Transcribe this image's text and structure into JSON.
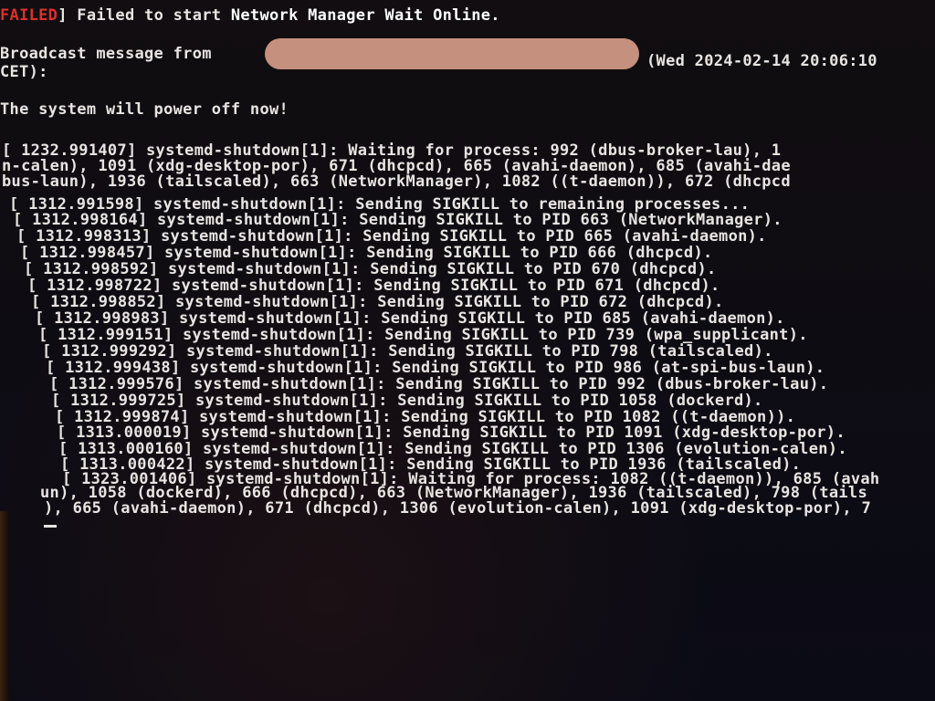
{
  "header": {
    "failed_tag": "FAILED",
    "failed_bracket": "] ",
    "failed_msg_plain": "Failed to start ",
    "failed_msg_bold": "Network Manager Wait Online."
  },
  "broadcast": {
    "prefix": "Broadcast message from",
    "redacted": true,
    "date": "(Wed 2024-02-14 20:06:10",
    "tz_line": "CET):",
    "message": "The system will power off now!"
  },
  "log_lines": [
    "[ 1232.991407] systemd-shutdown[1]: Waiting for process: 992 (dbus-broker-lau), 1",
    "n-calen), 1091 (xdg-desktop-por), 671 (dhcpcd), 665 (avahi-daemon), 685 (avahi-dae",
    "bus-laun), 1936 (tailscaled), 663 (NetworkManager), 1082 ((t-daemon)), 672 (dhcpcd",
    "[ 1312.991598] systemd-shutdown[1]: Sending SIGKILL to remaining processes...",
    "[ 1312.998164] systemd-shutdown[1]: Sending SIGKILL to PID 663 (NetworkManager).",
    "[ 1312.998313] systemd-shutdown[1]: Sending SIGKILL to PID 665 (avahi-daemon).",
    "[ 1312.998457] systemd-shutdown[1]: Sending SIGKILL to PID 666 (dhcpcd).",
    "[ 1312.998592] systemd-shutdown[1]: Sending SIGKILL to PID 670 (dhcpcd).",
    "[ 1312.998722] systemd-shutdown[1]: Sending SIGKILL to PID 671 (dhcpcd).",
    "[ 1312.998852] systemd-shutdown[1]: Sending SIGKILL to PID 672 (dhcpcd).",
    "[ 1312.998983] systemd-shutdown[1]: Sending SIGKILL to PID 685 (avahi-daemon).",
    "[ 1312.999151] systemd-shutdown[1]: Sending SIGKILL to PID 739 (wpa_supplicant).",
    "[ 1312.999292] systemd-shutdown[1]: Sending SIGKILL to PID 798 (tailscaled).",
    "[ 1312.999438] systemd-shutdown[1]: Sending SIGKILL to PID 986 (at-spi-bus-laun).",
    "[ 1312.999576] systemd-shutdown[1]: Sending SIGKILL to PID 992 (dbus-broker-lau).",
    "[ 1312.999725] systemd-shutdown[1]: Sending SIGKILL to PID 1058 (dockerd).",
    "[ 1312.999874] systemd-shutdown[1]: Sending SIGKILL to PID 1082 ((t-daemon)).",
    "[ 1313.000019] systemd-shutdown[1]: Sending SIGKILL to PID 1091 (xdg-desktop-por).",
    "[ 1313.000160] systemd-shutdown[1]: Sending SIGKILL to PID 1306 (evolution-calen).",
    "[ 1313.000422] systemd-shutdown[1]: Sending SIGKILL to PID 1936 (tailscaled).",
    "[ 1323.001406] systemd-shutdown[1]: Waiting for process: 1082 ((t-daemon)), 685 (avah",
    "un), 1058 (dockerd), 666 (dhcpcd), 663 (NetworkManager), 1936 (tailscaled), 798 (tails",
    "), 665 (avahi-daemon), 671 (dhcpcd), 1306 (evolution-calen), 1091 (xdg-desktop-por), 7"
  ],
  "colors": {
    "failed": "#e0302a",
    "text": "#e8e4e2",
    "background": "#0c0b12",
    "redaction": "#c6907e"
  }
}
